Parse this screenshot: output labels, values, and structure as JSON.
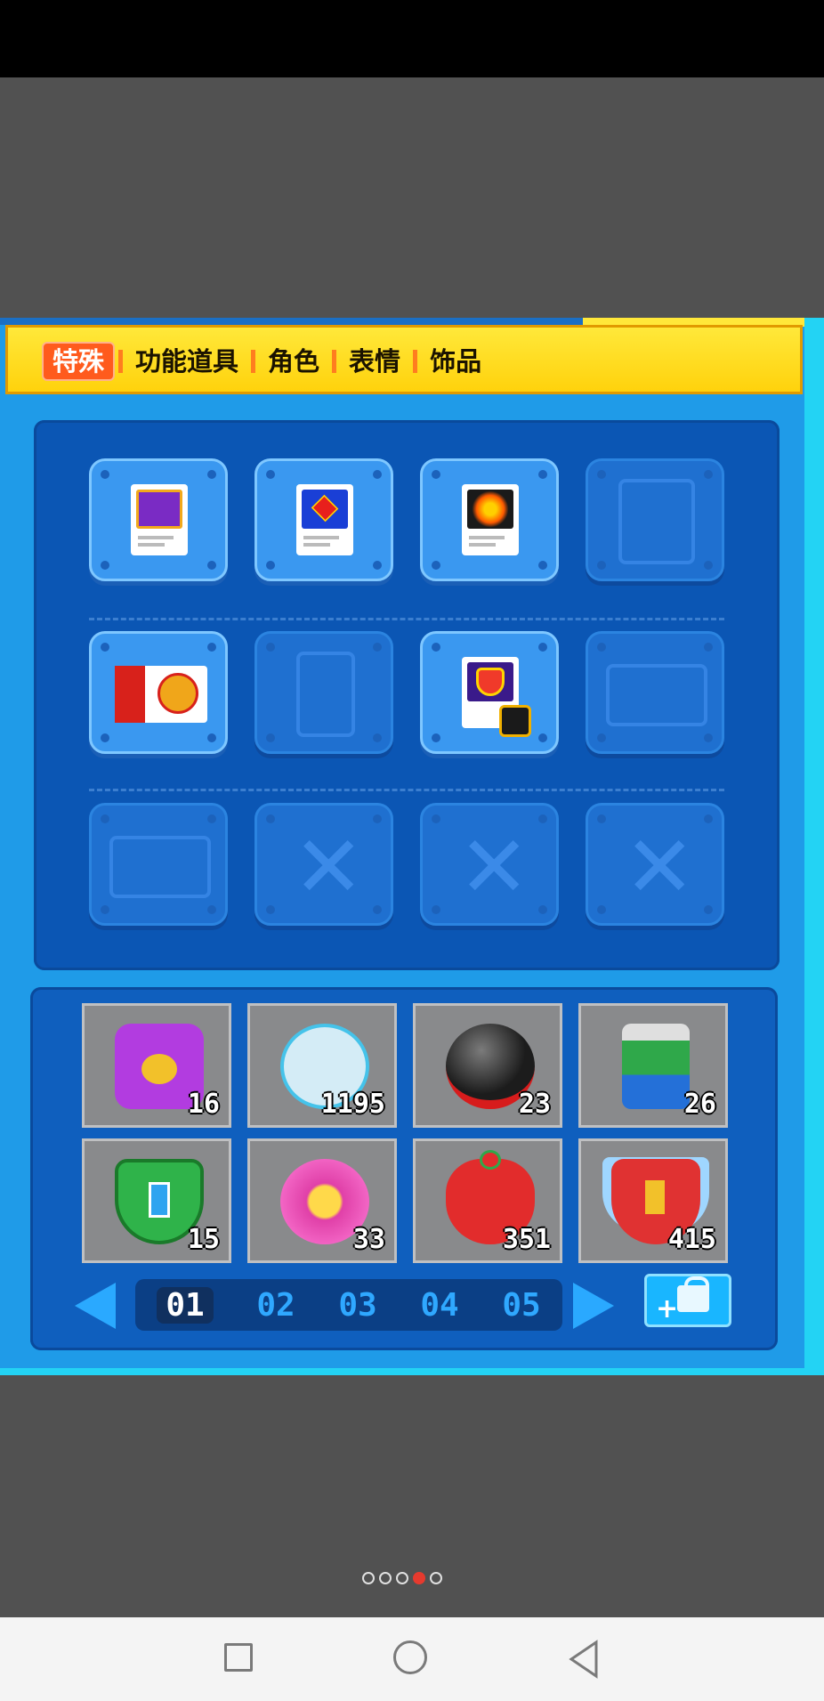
{
  "tabs": [
    {
      "label": "特殊",
      "active": true
    },
    {
      "label": "功能道具",
      "active": false
    },
    {
      "label": "角色",
      "active": false
    },
    {
      "label": "表情",
      "active": false
    },
    {
      "label": "饰品",
      "active": false
    }
  ],
  "equip_slots": [
    {
      "state": "filled",
      "icon": "s-card-icon"
    },
    {
      "state": "filled",
      "icon": "superman-card-icon"
    },
    {
      "state": "filled",
      "icon": "fire-card-icon"
    },
    {
      "state": "empty",
      "icon": "tip-card-placeholder-icon"
    },
    {
      "state": "filled",
      "icon": "chance-card-icon"
    },
    {
      "state": "empty",
      "icon": "sound-card-placeholder-icon"
    },
    {
      "state": "filled",
      "icon": "heart-plus-card-icon"
    },
    {
      "state": "empty",
      "icon": "certificate-placeholder-icon"
    },
    {
      "state": "empty",
      "icon": "love-card-placeholder-icon"
    },
    {
      "state": "empty",
      "icon": "x-placeholder-icon"
    },
    {
      "state": "empty",
      "icon": "x-placeholder-icon"
    },
    {
      "state": "empty",
      "icon": "x-placeholder-icon"
    }
  ],
  "inventory": [
    {
      "icon": "purple-chest-icon",
      "count": "16"
    },
    {
      "icon": "speed-shoe-icon",
      "count": "1195"
    },
    {
      "icon": "bomb-icon",
      "count": "23"
    },
    {
      "icon": "paint-can-icon",
      "count": "26"
    },
    {
      "icon": "green-shield-icon",
      "count": "15"
    },
    {
      "icon": "heart-potion-icon",
      "count": "33"
    },
    {
      "icon": "strawberry-pet-icon",
      "count": "351"
    },
    {
      "icon": "winged-red-shield-icon",
      "count": "415"
    }
  ],
  "pages": [
    "01",
    "02",
    "03",
    "04",
    "05"
  ],
  "active_page": "01",
  "colors": {
    "tab_active": "#ff5b1d",
    "panel": "#0b56b4",
    "accent": "#2aa9ff"
  }
}
